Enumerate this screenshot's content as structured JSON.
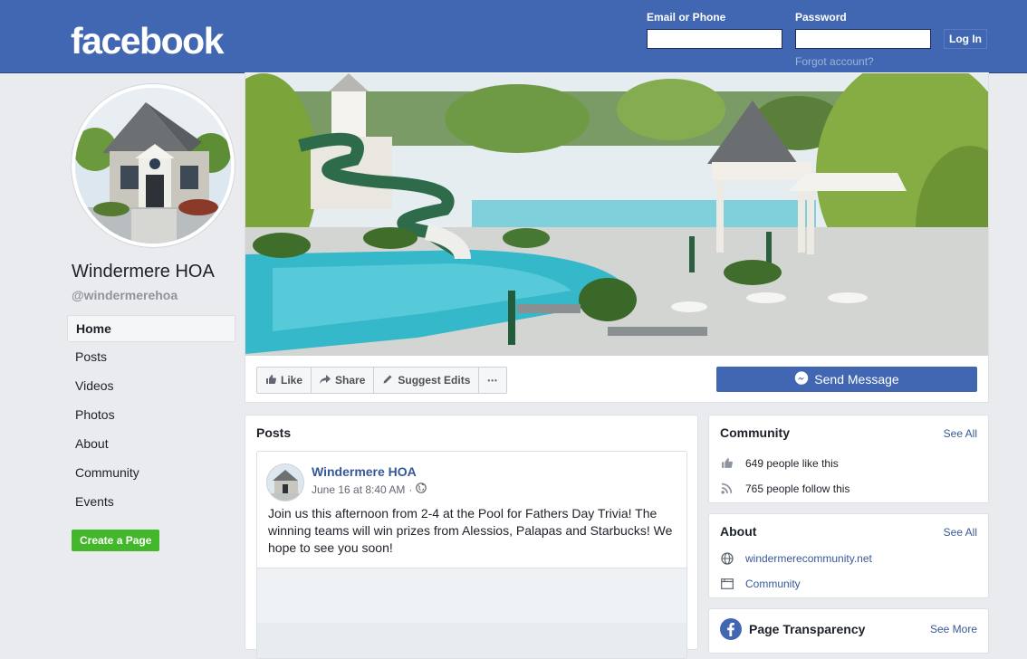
{
  "header": {
    "logo": "facebook",
    "email_label": "Email or Phone",
    "password_label": "Password",
    "login_button": "Log In",
    "forgot_link": "Forgot account?"
  },
  "page": {
    "name": "Windermere HOA",
    "handle": "@windermerehoa"
  },
  "nav": {
    "items": [
      {
        "label": "Home"
      },
      {
        "label": "Posts"
      },
      {
        "label": "Videos"
      },
      {
        "label": "Photos"
      },
      {
        "label": "About"
      },
      {
        "label": "Community"
      },
      {
        "label": "Events"
      }
    ],
    "create_page": "Create a Page"
  },
  "actions": {
    "like": "Like",
    "share": "Share",
    "suggest_edits": "Suggest Edits",
    "more": "•••",
    "send_message": "Send Message"
  },
  "posts": {
    "title": "Posts",
    "post": {
      "author": "Windermere HOA",
      "timestamp": "June 16 at 8:40 AM",
      "separator": "·",
      "text": "Join us this afternoon from 2-4 at the Pool for Fathers Day Trivia! The winning teams will win prizes from Alessios, Palapas and Starbucks! We hope to see you soon!"
    }
  },
  "community": {
    "title": "Community",
    "see_all": "See All",
    "likes": "649 people like this",
    "follows": "765 people follow this"
  },
  "about": {
    "title": "About",
    "see_all": "See All",
    "website": "windermerecommunity.net",
    "category": "Community"
  },
  "transparency": {
    "title": "Page Transparency",
    "see_more": "See More"
  },
  "colors": {
    "brand": "#4267b2",
    "link": "#385898",
    "create_green": "#42b72a",
    "background": "#e9ebee"
  },
  "icons": [
    "like-icon",
    "share-icon",
    "pencil-icon",
    "messenger-icon",
    "globe-icon",
    "thumbs-up-icon",
    "rss-icon",
    "folder-icon",
    "facebook-icon"
  ]
}
